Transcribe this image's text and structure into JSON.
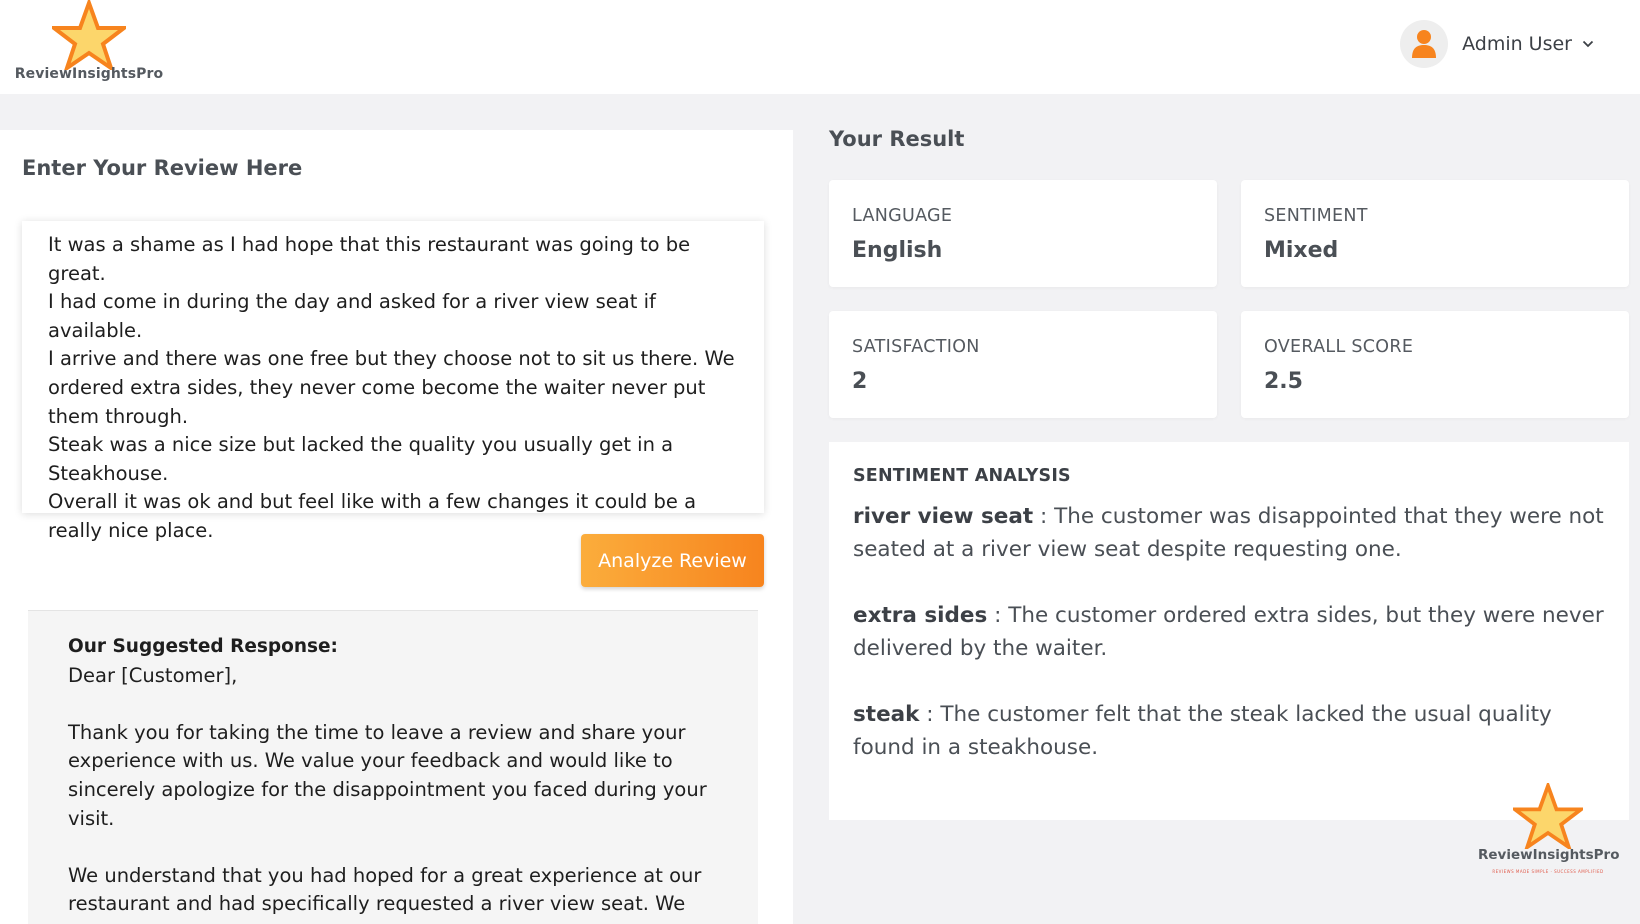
{
  "brand": {
    "name": "ReviewInsightsPro",
    "tagline": "REVIEWS MADE SIMPLE · SUCCESS AMPLIFIED",
    "colors": {
      "accent": "#f7841e",
      "star_fill": "#fcd66b"
    }
  },
  "header": {
    "user_name": "Admin User",
    "avatar_icon": "user-icon",
    "dropdown_icon": "chevron-down-icon"
  },
  "input_panel": {
    "title": "Enter Your Review Here",
    "review_text": "It was a shame as I had hope that this restaurant was going to be great.\nI had come in during the day and asked for a river view seat if available.\nI arrive and there was one free but they choose not to sit us there. We ordered extra sides, they never come become the waiter never put them through.\nSteak was a nice size but lacked the quality you usually get in a Steakhouse.\nOverall it was ok and but feel like with a few changes it could be a really nice place.",
    "analyze_button": "Analyze Review"
  },
  "suggested_response": {
    "heading": "Our Suggested Response:",
    "salutation": "Dear [Customer],",
    "paragraphs": [
      "Thank you for taking the time to leave a review and share your experience with us. We value your feedback and would like to sincerely apologize for the disappointment you faced during your visit.",
      "We understand that you had hoped for a great experience at our restaurant and had specifically requested a river view seat. We"
    ]
  },
  "result": {
    "title": "Your Result",
    "cards": [
      {
        "label": "LANGUAGE",
        "value": "English"
      },
      {
        "label": "SENTIMENT",
        "value": "Mixed"
      },
      {
        "label": "SATISFACTION",
        "value": "2"
      },
      {
        "label": "OVERALL SCORE",
        "value": "2.5"
      }
    ],
    "analysis_title": "SENTIMENT ANALYSIS",
    "analysis": [
      {
        "term": "river view seat",
        "separator": " : ",
        "text": "The customer was disappointed that they were not seated at a river view seat despite requesting one."
      },
      {
        "term": "extra sides",
        "separator": " : ",
        "text": "The customer ordered extra sides, but they were never delivered by the waiter."
      },
      {
        "term": "steak",
        "separator": " : ",
        "text": "The customer felt that the steak lacked the usual quality found in a steakhouse."
      }
    ]
  }
}
